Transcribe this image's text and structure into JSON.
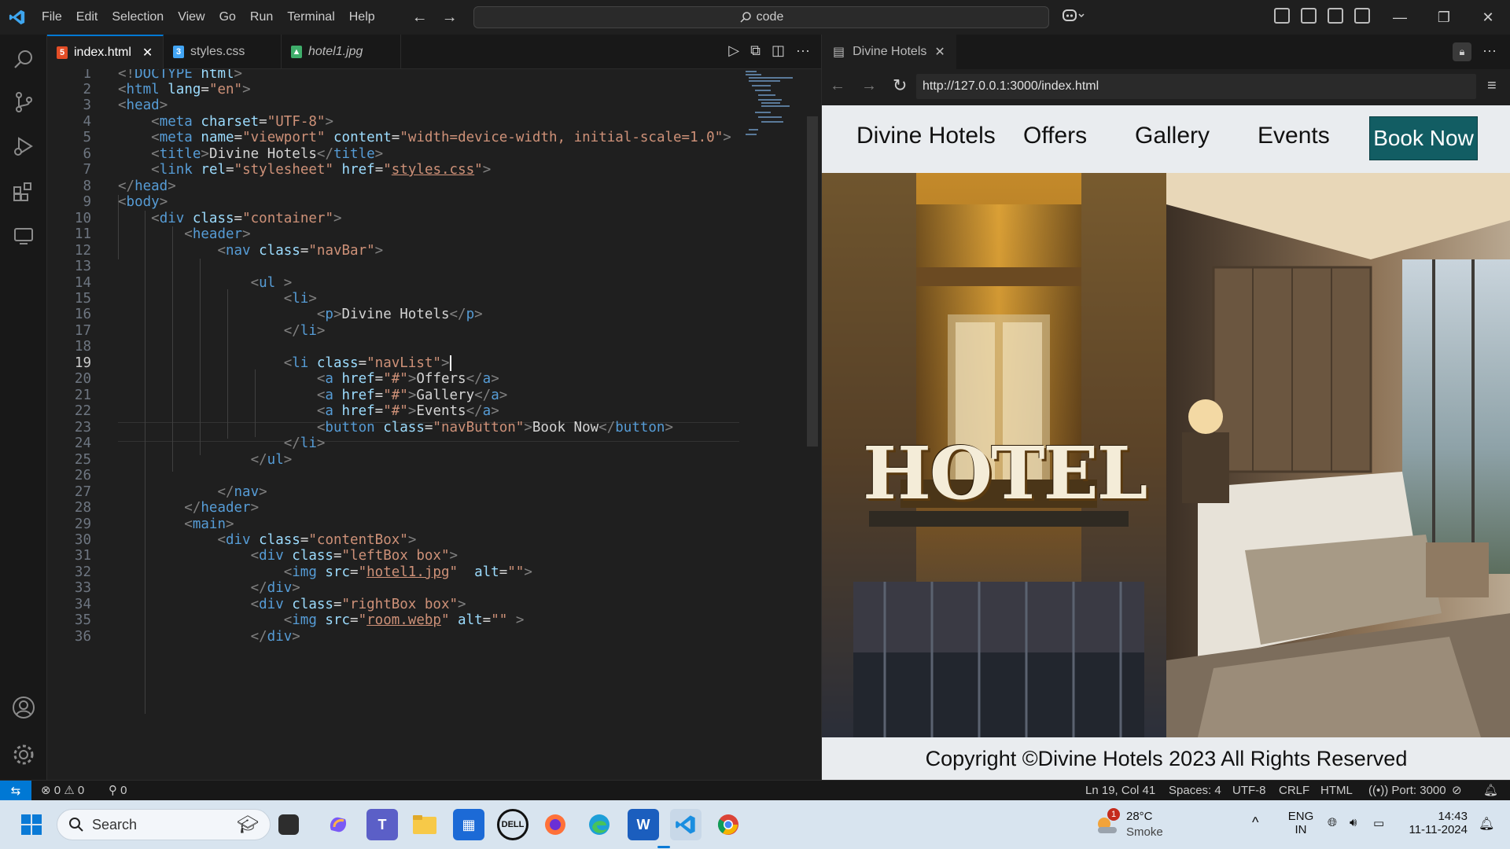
{
  "titlebar": {
    "menu": [
      "File",
      "Edit",
      "Selection",
      "View",
      "Go",
      "Run",
      "Terminal",
      "Help"
    ],
    "command_center": "code"
  },
  "tabs": [
    {
      "label": "index.html",
      "icon": "html-file-icon",
      "active": true
    },
    {
      "label": "styles.css",
      "icon": "css-file-icon",
      "active": false
    },
    {
      "label": "hotel1.jpg",
      "icon": "image-file-icon",
      "active": false
    }
  ],
  "editor": {
    "current_line": 19,
    "lines": [
      {
        "n": "1"
      },
      {
        "n": "2"
      },
      {
        "n": "3"
      },
      {
        "n": "4"
      },
      {
        "n": "5"
      },
      {
        "n": "6"
      },
      {
        "n": "7"
      },
      {
        "n": "8"
      },
      {
        "n": "9"
      },
      {
        "n": "10"
      },
      {
        "n": "11"
      },
      {
        "n": "12"
      },
      {
        "n": "13"
      },
      {
        "n": "14"
      },
      {
        "n": "15"
      },
      {
        "n": "16"
      },
      {
        "n": "17"
      },
      {
        "n": "18"
      },
      {
        "n": "19"
      },
      {
        "n": "20"
      },
      {
        "n": "21"
      },
      {
        "n": "22"
      },
      {
        "n": "23"
      },
      {
        "n": "24"
      },
      {
        "n": "25"
      },
      {
        "n": "26"
      },
      {
        "n": "27"
      },
      {
        "n": "28"
      },
      {
        "n": "29"
      },
      {
        "n": "30"
      },
      {
        "n": "31"
      },
      {
        "n": "32"
      },
      {
        "n": "33"
      },
      {
        "n": "34"
      },
      {
        "n": "35"
      },
      {
        "n": "36"
      }
    ]
  },
  "browser": {
    "tab_title": "Divine Hotels",
    "url": "http://127.0.0.1:3000/index.html",
    "site": {
      "brand": "Divine Hotels",
      "links": [
        "Offers",
        "Gallery",
        "Events"
      ],
      "button": "Book Now",
      "footer": "Copyright ©Divine Hotels 2023 All Rights Reserved",
      "hotel_sign": "HOTEL"
    }
  },
  "statusbar": {
    "errors": "0",
    "warnings": "0",
    "ports": "0",
    "position": "Ln 19, Col 41",
    "spaces": "Spaces: 4",
    "encoding": "UTF-8",
    "eol": "CRLF",
    "language": "HTML",
    "port": "Port: 3000"
  },
  "taskbar": {
    "search_placeholder": "Search",
    "weather_temp": "28°C",
    "weather_desc": "Smoke",
    "weather_badge": "1",
    "lang_line1": "ENG",
    "lang_line2": "IN",
    "time": "14:43",
    "date": "11-11-2024"
  },
  "colors": {
    "accent": "#0078d4",
    "site_button": "#125d63",
    "site_header": "#e9ecef"
  }
}
